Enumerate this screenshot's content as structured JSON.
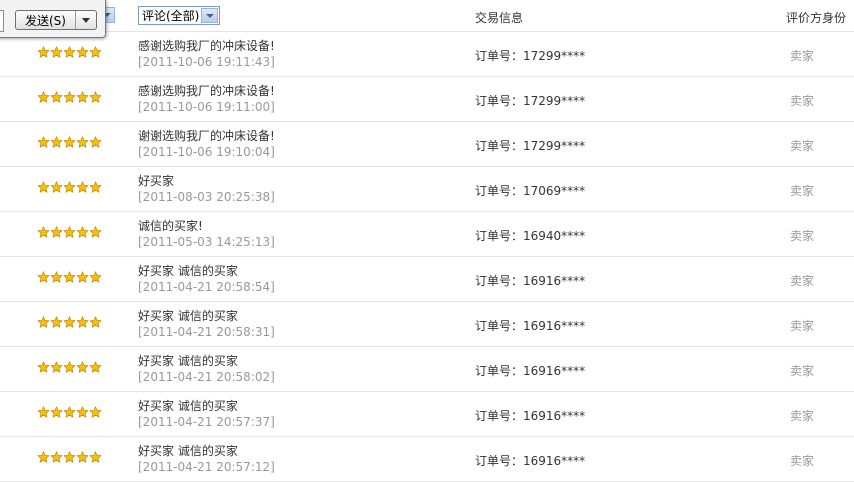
{
  "header": {
    "filter_label": "评论(全部)",
    "trade_info_label": "交易信息",
    "role_label": "评价方身份"
  },
  "send_widget": {
    "label": "发送(S)"
  },
  "colors": {
    "star_fill": "#f5c010",
    "star_stroke": "#c98a00",
    "muted_text": "#999999",
    "divider": "#e4e4e4"
  },
  "reviews": [
    {
      "rating": 5,
      "comment": "感谢选购我厂的冲床设备!",
      "time": "[2011-10-06 19:11:43]",
      "order": "订单号：17299****",
      "role": "卖家"
    },
    {
      "rating": 5,
      "comment": "感谢选购我厂的冲床设备!",
      "time": "[2011-10-06 19:11:00]",
      "order": "订单号：17299****",
      "role": "卖家"
    },
    {
      "rating": 5,
      "comment": "谢谢选购我厂的冲床设备!",
      "time": "[2011-10-06 19:10:04]",
      "order": "订单号：17299****",
      "role": "卖家"
    },
    {
      "rating": 5,
      "comment": "好买家",
      "time": "[2011-08-03 20:25:38]",
      "order": "订单号：17069****",
      "role": "卖家"
    },
    {
      "rating": 5,
      "comment": "诚信的买家!",
      "time": "[2011-05-03 14:25:13]",
      "order": "订单号：16940****",
      "role": "卖家"
    },
    {
      "rating": 5,
      "comment": "好买家 诚信的买家",
      "time": "[2011-04-21 20:58:54]",
      "order": "订单号：16916****",
      "role": "卖家"
    },
    {
      "rating": 5,
      "comment": "好买家 诚信的买家",
      "time": "[2011-04-21 20:58:31]",
      "order": "订单号：16916****",
      "role": "卖家"
    },
    {
      "rating": 5,
      "comment": "好买家 诚信的买家",
      "time": "[2011-04-21 20:58:02]",
      "order": "订单号：16916****",
      "role": "卖家"
    },
    {
      "rating": 5,
      "comment": "好买家 诚信的买家",
      "time": "[2011-04-21 20:57:37]",
      "order": "订单号：16916****",
      "role": "卖家"
    },
    {
      "rating": 5,
      "comment": "好买家 诚信的买家",
      "time": "[2011-04-21 20:57:12]",
      "order": "订单号：16916****",
      "role": "卖家"
    }
  ]
}
